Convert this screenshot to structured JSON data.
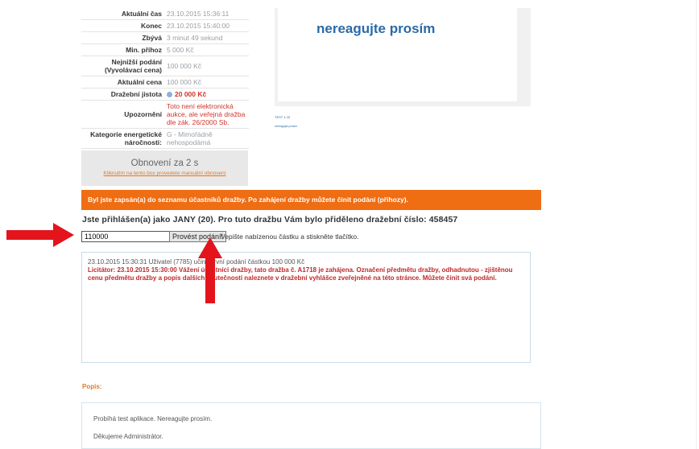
{
  "auction_info": [
    {
      "label": "Aktuální čas",
      "value": "23.10.2015 15:36:11"
    },
    {
      "label": "Konec",
      "value": "23.10.2015 15:40:00"
    },
    {
      "label": "Zbývá",
      "value": "3 minut 49 sekund"
    },
    {
      "label": "Min. příhoz",
      "value": "5 000 Kč"
    },
    {
      "label": "Nejnižší podání (Vyvolávací cena)",
      "value": "100 000 Kč"
    },
    {
      "label": "Aktuální cena",
      "value": "100 000 Kč"
    },
    {
      "label": "Dražební jistota",
      "value": "20 000 Kč"
    },
    {
      "label": "Upozornění",
      "value": "Toto není elektronická aukce, ale veřejná dražba dle zák. 26/2000 Sb."
    },
    {
      "label": "Kategorie energetické náročnosti:",
      "value": "G - Mimořádně nehospodárná"
    }
  ],
  "refresh": {
    "title": "Obnovení za 2 s",
    "link": "Kliknutím na tento box provedete manuální obnovení"
  },
  "banner": {
    "text": "nereagujte prosím",
    "tiny1": "TEST 1-10",
    "tiny2": "nereagujte prosím"
  },
  "notice": "Byl jste zapsán(a) do seznamu účastníků dražby. Po zahájení dražby můžete činit podání (příhozy).",
  "logged_in": "Jste přihlášen(a) jako JANY   (20). Pro tuto dražbu Vám bylo přiděleno dražební číslo: 458457",
  "bid": {
    "value": "110000",
    "button": "Provést podání!",
    "hint": "Vepište nabízenou částku a stiskněte tlačítko."
  },
  "log": {
    "line1": "23.10.2015 15:30:31 Uživatel (7785) učinil první podání částkou 100 000 Kč",
    "line2": "Licitátor: 23.10.2015 15:30:00 Vážení účastníci dražby, tato dražba č. A1718 je zahájena. Označení předmětu dražby, odhadnutou - zjištěnou cenu předmětu dražby a popis dalších skutečností naleznete v dražební vyhlášce zveřejněné na této stránce. Můžete činit svá podání."
  },
  "popis": {
    "heading": "Popis:",
    "p1": "Probíhá test aplikace. Nereagujte prosím.",
    "p2": "Děkujeme Administrátor."
  },
  "colors": {
    "orange": "#ef6d13",
    "arrow": "#e3141c",
    "link_blue": "#2b6aa8",
    "alert_red": "#c0282a"
  },
  "icons": [
    "shield-icon",
    "arrow-right-icon",
    "arrow-up-icon"
  ]
}
